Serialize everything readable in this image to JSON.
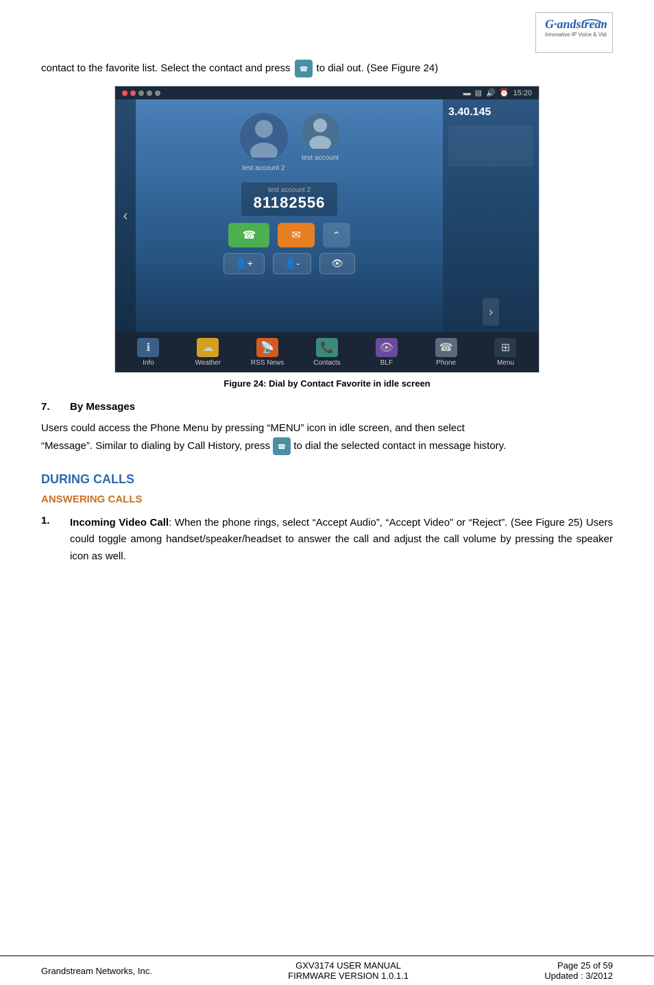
{
  "header": {
    "logo_alt": "Grandstream Logo",
    "logo_text": "G·andstream",
    "logo_tagline": "Innovative IP Voice & Video"
  },
  "intro": {
    "text_before": "contact to the favorite list. Select the contact and press",
    "text_after": "to dial out. (See Figure 24)"
  },
  "figure24": {
    "caption": "Figure 24: Dial by Contact Favorite in idle screen",
    "status_bar": {
      "dots": [
        "red",
        "yellow",
        "green",
        "gray",
        "gray"
      ],
      "right_text": "15:20"
    },
    "contacts": [
      {
        "name": "test account 2",
        "number": "81182556"
      },
      {
        "name": "test account",
        "number": ""
      }
    ],
    "ip_display": "3.40.145",
    "dock_items": [
      {
        "label": "Info",
        "icon": "ℹ",
        "color": "blue"
      },
      {
        "label": "Weather",
        "icon": "☁",
        "color": "yellow-g"
      },
      {
        "label": "RSS News",
        "icon": "📡",
        "color": "orange"
      },
      {
        "label": "Contacts",
        "icon": "📞",
        "color": "teal"
      },
      {
        "label": "BLF",
        "icon": "👁",
        "color": "purple"
      },
      {
        "label": "Phone",
        "icon": "☎",
        "color": "gray"
      },
      {
        "label": "Menu",
        "icon": "⊞",
        "color": "dark"
      }
    ]
  },
  "section7": {
    "number": "7.",
    "title": "By Messages",
    "body1": "Users could access the Phone Menu by pressing “MENU” icon in idle screen, and then select",
    "body2": "“Message”. Similar to dialing by Call History, press",
    "body3": "to dial the selected contact in message history."
  },
  "during_calls": {
    "heading": "DURING CALLS",
    "answering_calls": {
      "heading": "ANSWERING CALLS",
      "items": [
        {
          "number": "1.",
          "label": "Incoming Video Call",
          "colon": ":",
          "text": " When the phone rings, select “Accept Audio”, “Accept Video” or “Reject”. (See Figure 25) Users could toggle among handset/speaker/headset to answer the call and adjust the call volume by pressing the speaker icon as well."
        }
      ]
    }
  },
  "footer": {
    "left": "Grandstream Networks, Inc.",
    "center_line1": "GXV3174 USER MANUAL",
    "center_line2": "FIRMWARE VERSION 1.0.1.1",
    "right_line1": "Page 25 of 59",
    "right_line2": "Updated : 3/2012"
  }
}
